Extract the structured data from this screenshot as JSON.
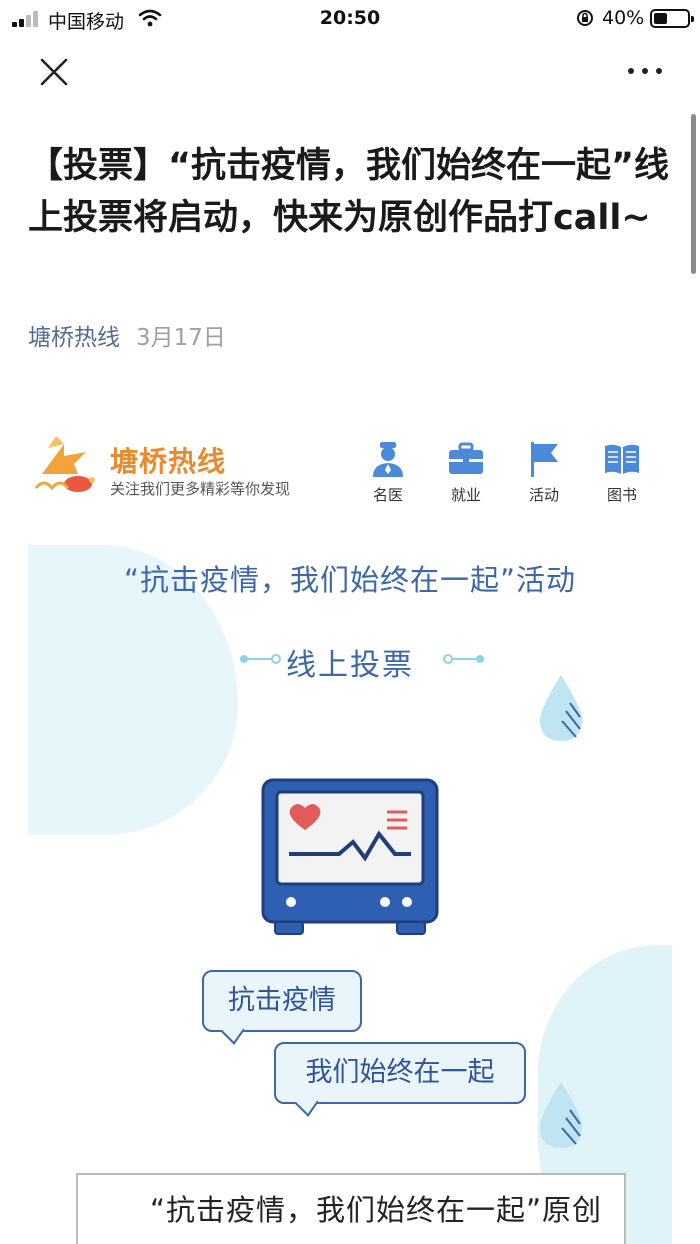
{
  "status_bar": {
    "carrier": "中国移动",
    "time": "20:50",
    "battery": "40%"
  },
  "article": {
    "title": "【投票】“抗击疫情，我们始终在一起”线上投票将启动，快来为原创作品打call~",
    "author": "塘桥热线",
    "date": "3月17日"
  },
  "brand": {
    "name": "塘桥热线",
    "slogan": "关注我们更多精彩等你发现"
  },
  "menu": [
    {
      "label": "名医",
      "icon": "doctor-icon"
    },
    {
      "label": "就业",
      "icon": "briefcase-icon"
    },
    {
      "label": "活动",
      "icon": "flag-icon"
    },
    {
      "label": "图书",
      "icon": "book-icon"
    }
  ],
  "poster": {
    "title": "“抗击疫情，我们始终在一起”活动",
    "subtitle": "线上投票",
    "bubble_1": "抗击疫情",
    "bubble_2": "我们始终在一起",
    "body_text": "“抗击疫情，我们始终在一起”原创作品征集评选活动在……年……月……"
  },
  "colors": {
    "link": "#576b95",
    "brand_orange": "#e88b2e",
    "poster_blue": "#3e67a8",
    "icon_blue": "#4a8ad8"
  }
}
